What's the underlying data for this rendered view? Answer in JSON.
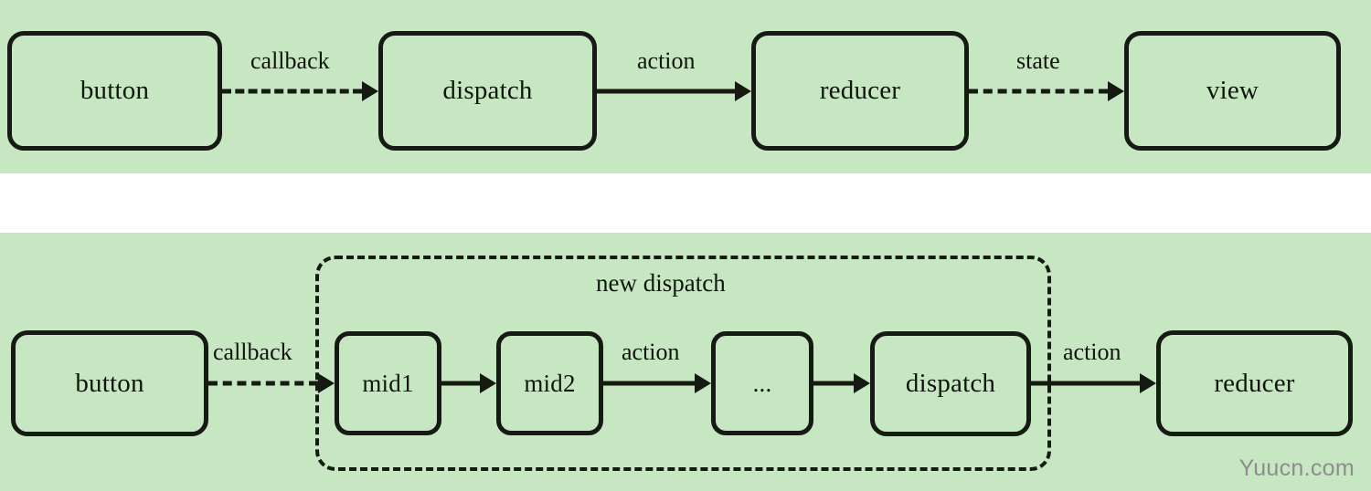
{
  "diagram": {
    "title_semantic": "redux-middleware-dispatch-flow",
    "background_color": "#c6e7c1",
    "page_background": "#ffffff",
    "stroke_color": "#151a12",
    "watermark": "Yuucn.com",
    "panels": [
      {
        "id": "standard-flow",
        "nodes": [
          {
            "id": "button",
            "label": "button"
          },
          {
            "id": "dispatch",
            "label": "dispatch"
          },
          {
            "id": "reducer",
            "label": "reducer"
          },
          {
            "id": "view",
            "label": "view"
          }
        ],
        "edges": [
          {
            "from": "button",
            "to": "dispatch",
            "label": "callback",
            "style": "dashed"
          },
          {
            "from": "dispatch",
            "to": "reducer",
            "label": "action",
            "style": "solid"
          },
          {
            "from": "reducer",
            "to": "view",
            "label": "state",
            "style": "dashed"
          }
        ]
      },
      {
        "id": "middleware-flow",
        "group": {
          "id": "new-dispatch",
          "label": "new dispatch",
          "style": "dashed"
        },
        "nodes": [
          {
            "id": "button",
            "label": "button",
            "in_group": false
          },
          {
            "id": "mid1",
            "label": "mid1",
            "in_group": true
          },
          {
            "id": "mid2",
            "label": "mid2",
            "in_group": true
          },
          {
            "id": "ellipsis",
            "label": "...",
            "in_group": true
          },
          {
            "id": "dispatch",
            "label": "dispatch",
            "in_group": true
          },
          {
            "id": "reducer",
            "label": "reducer",
            "in_group": false
          }
        ],
        "edges": [
          {
            "from": "button",
            "to": "mid1",
            "label": "callback",
            "style": "dashed"
          },
          {
            "from": "mid1",
            "to": "mid2",
            "label": "",
            "style": "solid"
          },
          {
            "from": "mid2",
            "to": "ellipsis",
            "label": "action",
            "style": "solid"
          },
          {
            "from": "ellipsis",
            "to": "dispatch",
            "label": "",
            "style": "solid"
          },
          {
            "from": "dispatch",
            "to": "reducer",
            "label": "action",
            "style": "solid"
          }
        ]
      }
    ]
  }
}
